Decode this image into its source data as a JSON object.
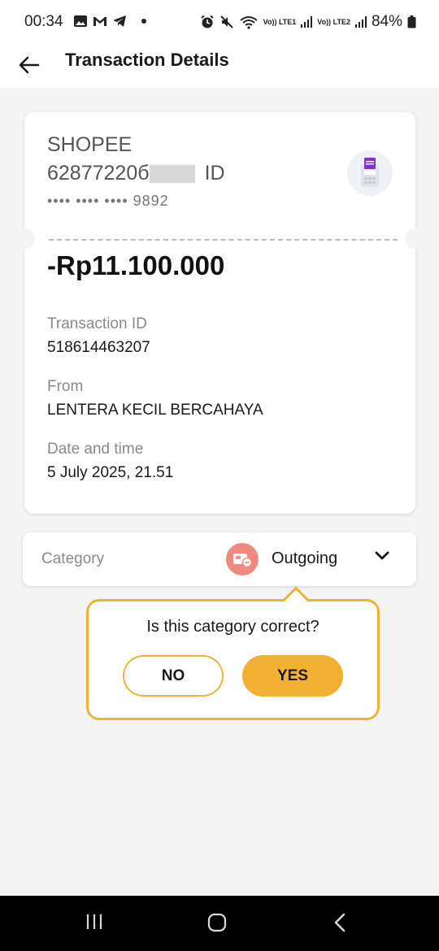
{
  "status": {
    "time": "00:34",
    "net1": "Vo)) LTE1",
    "net2": "Vo)) LTE2",
    "battery": "84%"
  },
  "header": {
    "title": "Transaction Details"
  },
  "card": {
    "merchant": "SHOPEE",
    "account_number": "62877220б",
    "account_suffix": "ID",
    "card_number": "•••• •••• •••• 9892",
    "amount": "-Rp11.100.000",
    "fields": [
      {
        "label": "Transaction ID",
        "value": "518614463207"
      },
      {
        "label": "From",
        "value": "LENTERA KECIL BERCAHAYA"
      },
      {
        "label": "Date and time",
        "value": "5 July 2025, 21.51"
      }
    ]
  },
  "category": {
    "label": "Category",
    "value": "Outgoing",
    "icon_color": "#f08a80"
  },
  "confirm": {
    "question": "Is this category correct?",
    "no_label": "NO",
    "yes_label": "YES",
    "accent": "#f2b134"
  },
  "icons": {
    "back": "arrow-left-icon",
    "edc": "edc-terminal-icon",
    "category": "outgoing-icon",
    "chevron": "chevron-down-icon",
    "nav_recents": "recents-icon",
    "nav_home": "home-icon",
    "nav_back": "back-icon"
  }
}
